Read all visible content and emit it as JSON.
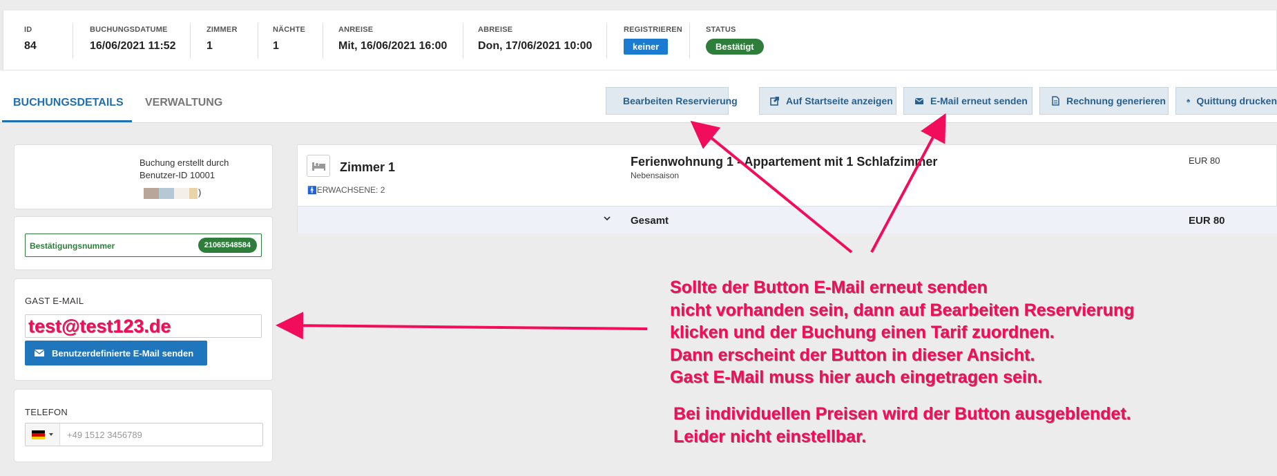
{
  "booking_info": {
    "id": {
      "label": "ID",
      "value": "84"
    },
    "booking_date": {
      "label": "BUCHUNGSDATUME",
      "value": "16/06/2021 11:52"
    },
    "rooms": {
      "label": "ZIMMER",
      "value": "1"
    },
    "nights": {
      "label": "NÄCHTE",
      "value": "1"
    },
    "arrival": {
      "label": "ANREISE",
      "value": "Mit, 16/06/2021 16:00"
    },
    "departure": {
      "label": "ABREISE",
      "value": "Don, 17/06/2021 10:00"
    },
    "register": {
      "label": "REGISTRIEREN",
      "value": "keiner"
    },
    "status": {
      "label": "STATUS",
      "value": "Bestätigt"
    }
  },
  "tabs": {
    "details": "BUCHUNGSDETAILS",
    "management": "VERWALTUNG"
  },
  "actions": {
    "edit": "Bearbeiten Reservierung",
    "show_front": "Auf Startseite anzeigen",
    "resend_email": "E-Mail erneut senden",
    "invoice": "Rechnung generieren",
    "receipt": "Quittung drucken"
  },
  "created_by": {
    "line1": "Buchung erstellt durch",
    "line2": "Benutzer-ID 10001",
    "line3_suffix": ")"
  },
  "confirmation": {
    "label": "Bestätigungsnummer",
    "number": "21065548584"
  },
  "guest_email": {
    "label": "GAST E-MAIL",
    "value": "test@test123.de",
    "button": "Benutzerdefinierte E-Mail senden"
  },
  "phone": {
    "label": "TELEFON",
    "placeholder": "+49 1512 3456789"
  },
  "room": {
    "name": "Zimmer 1",
    "adults": "ERWACHSENE: 2",
    "apartment": "Ferienwohnung 1 - Appartement mit 1 Schlafzimmer",
    "season": "Nebensaison",
    "price": "EUR 80",
    "total_label": "Gesamt",
    "total_value": "EUR 80"
  },
  "annotation": {
    "line1": "Sollte der Button E-Mail erneut senden",
    "line2": "nicht vorhanden sein, dann auf Bearbeiten Reservierung",
    "line3": "klicken und der Buchung einen Tarif zuordnen.",
    "line4": "Dann erscheint der Button in dieser Ansicht.",
    "line5": "Gast E-Mail muss hier auch eingetragen sein.",
    "line6": "Bei individuellen Preisen wird der Button ausgeblendet.",
    "line7": "Leider nicht einstellbar.",
    "color": "#f10d5c"
  },
  "colors": {
    "accent_blue": "#1f6fb5",
    "confirm_green": "#2f7d3a",
    "register_blue": "#1a7bd0"
  }
}
